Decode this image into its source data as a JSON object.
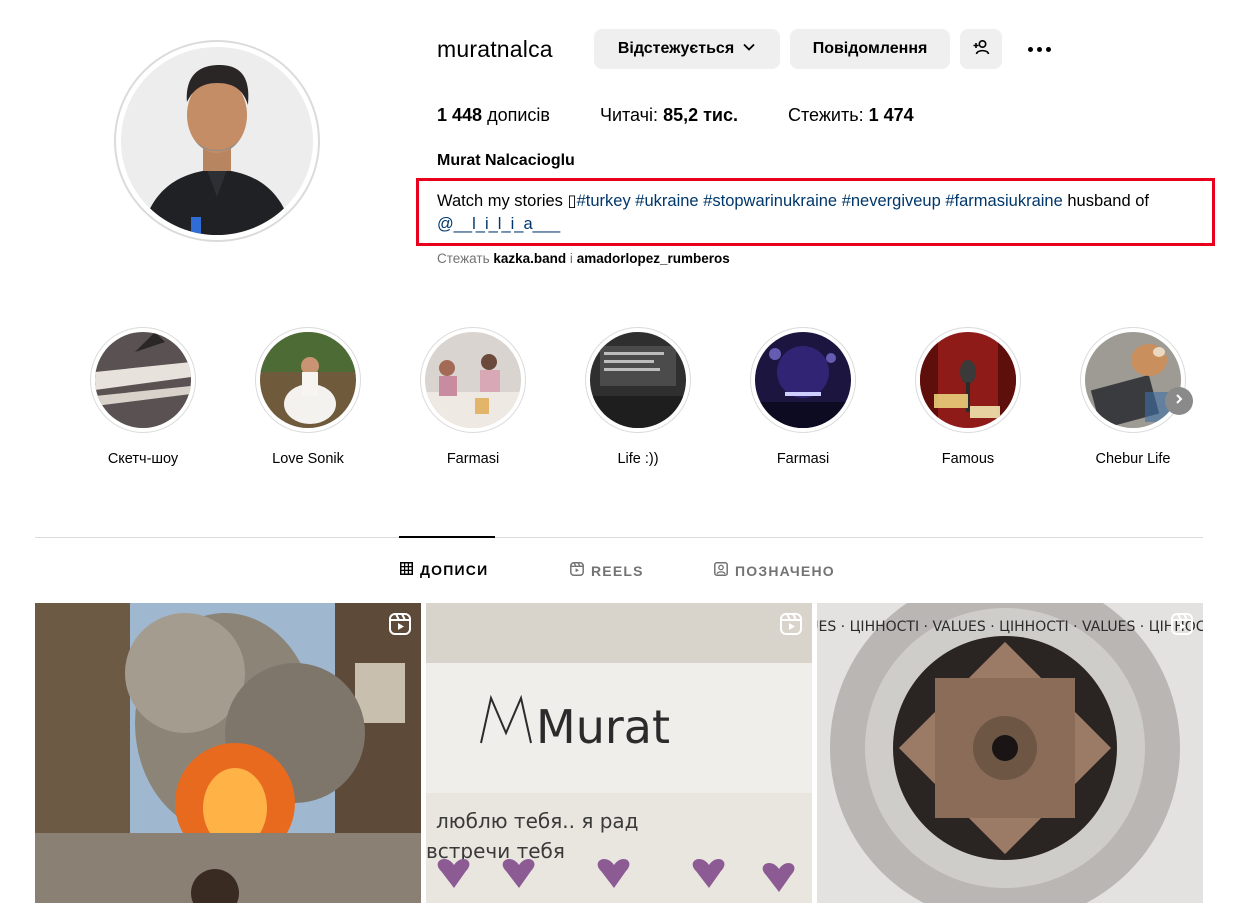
{
  "profile": {
    "username": "muratnalca",
    "full_name": "Murat Nalcacioglu",
    "buttons": {
      "following": "Відстежується",
      "message": "Повідомлення"
    },
    "stats": {
      "posts_count": "1 448",
      "posts_label": "дописів",
      "followers_label": "Читачі:",
      "followers_count": "85,2 тис.",
      "following_label": "Стежить:",
      "following_count": "1 474"
    },
    "bio": {
      "text_start": "Watch my stories ",
      "placeholder_glyph": "▯",
      "tags": [
        "#turkey",
        "#ukraine",
        "#stopwarinukraine",
        "#nevergiveup",
        "#farmasiukraine"
      ],
      "text_mid": " husband of",
      "mention": "@__l_i_l_i_a___"
    },
    "followed_by": {
      "prefix": "Стежать",
      "user1": "kazka.band",
      "sep": "і",
      "user2": "amadorlopez_rumberos"
    }
  },
  "highlights": [
    {
      "label": "Скетч-шоу"
    },
    {
      "label": "Love Sonik"
    },
    {
      "label": "Farmasi"
    },
    {
      "label": "Life :))"
    },
    {
      "label": "Farmasi"
    },
    {
      "label": "Famous"
    },
    {
      "label": "Chebur Life"
    }
  ],
  "tabs": {
    "posts": "ДОПИСИ",
    "reels": "REELS",
    "tagged": "ПОЗНАЧЕНО"
  },
  "posts": [
    {
      "kind": "reel",
      "icon": "reel-icon"
    },
    {
      "kind": "reel",
      "icon": "reel-icon",
      "handwriting": "Murat",
      "handwriting2": "люблю тебя.. я рад",
      "handwriting3": "встречи тебя"
    },
    {
      "kind": "reel",
      "icon": "reel-icon",
      "ring_text": "VALUES · ЦІННОСТІ · VALUES · ЦІННОСТІ · VALUES · ЦІННОСТІ ·"
    }
  ],
  "colors": {
    "accent_link": "#00376b",
    "highlight_box": "#e8001c",
    "button_bg": "#efefef",
    "muted": "#737373",
    "divider": "#dbdbdb"
  }
}
